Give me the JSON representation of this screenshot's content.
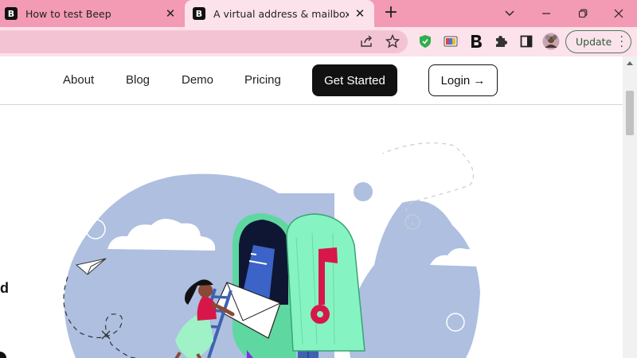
{
  "browser": {
    "tabs": [
      {
        "title": "How to test Beep",
        "favicon": "beep-logo-icon",
        "active": false
      },
      {
        "title": "A virtual address & mailbox for b",
        "favicon": "beep-logo-icon",
        "active": true
      }
    ],
    "favicon_letter": "B",
    "new_tab_symbol": "+",
    "window_controls": [
      "chevron-down-icon",
      "minimize-icon",
      "restore-icon",
      "close-icon"
    ],
    "toolbar_icons": [
      "share-icon",
      "star-icon",
      "shield-extension-icon",
      "color-extension-icon",
      "beep-extension-icon",
      "puzzle-extension-icon",
      "sidepanel-icon",
      "profile-avatar"
    ],
    "update_label": "Update",
    "colors": {
      "tabstrip": "#f39ab5",
      "toolbar": "#fce2ea",
      "omnibox": "#f4c3d3"
    }
  },
  "site": {
    "nav": {
      "links": [
        "About",
        "Blog",
        "Demo",
        "Pricing"
      ],
      "get_started": "Get Started",
      "login": "Login →"
    },
    "hero_fragment": "d",
    "colors": {
      "cta": "#111111",
      "mailbox": "#86f4c2",
      "flag": "#d7174a",
      "blob": "#aebfe0",
      "post": "#3e62b0"
    }
  }
}
